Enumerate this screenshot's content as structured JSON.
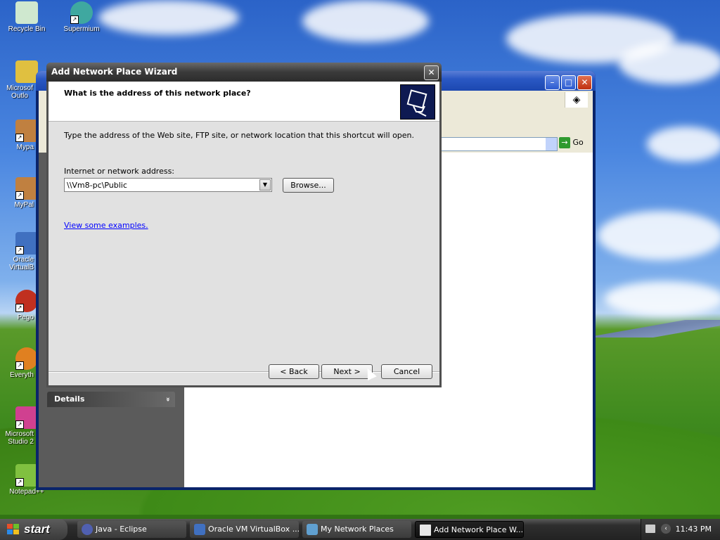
{
  "desktop": {
    "icons": [
      {
        "label": "Recycle Bin",
        "color": "#8fcf8f"
      },
      {
        "label": "Supermium",
        "color": "#3fa8a0"
      },
      {
        "label": "Microsof Outlo",
        "color": "#e0c040"
      },
      {
        "label": "Mypa",
        "color": "#c08040"
      },
      {
        "label": "MyPal",
        "color": "#c08040"
      },
      {
        "label": "Oracle VirtualB",
        "color": "#4070c0"
      },
      {
        "label": "Pego",
        "color": "#c03020"
      },
      {
        "label": "Everyth",
        "color": "#e08020"
      },
      {
        "label": "Microsoft Studio 2",
        "color": "#d04090"
      },
      {
        "label": "Notepad++",
        "color": "#80c040"
      }
    ]
  },
  "explorer": {
    "go_label": "Go",
    "details_label": "Details",
    "details_chevron": "»"
  },
  "wizard": {
    "title": "Add Network Place Wizard",
    "close_symbol": "✕",
    "heading": "What is the address of this network place?",
    "description": "Type the address of the Web site, FTP site, or network location that this shortcut will open.",
    "address_label": "Internet or network address:",
    "address_value": "\\\\Vm8-pc\\Public",
    "browse_label": "Browse...",
    "examples_link": "View some examples.",
    "back_label": "< Back",
    "next_label": "Next >",
    "cancel_label": "Cancel"
  },
  "taskbar": {
    "start_label": "start",
    "tasks": [
      {
        "label": "Java - Eclipse",
        "icon": "eclipse-icon",
        "color": "#5060b0"
      },
      {
        "label": "Oracle VM VirtualBox ...",
        "icon": "virtualbox-icon",
        "color": "#4070c0"
      },
      {
        "label": "My Network Places",
        "icon": "network-places-icon",
        "color": "#60a0d0"
      },
      {
        "label": "Add Network Place W...",
        "icon": "window-icon",
        "color": "#e8e8e8"
      }
    ],
    "clock": "11:43 PM"
  }
}
